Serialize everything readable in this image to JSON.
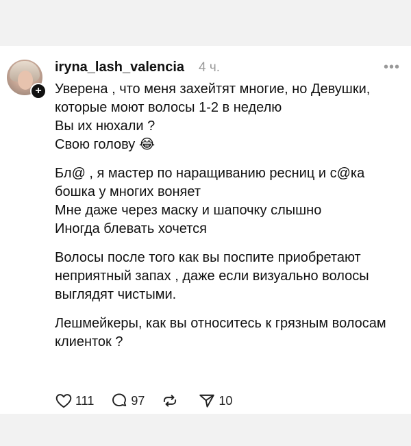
{
  "post": {
    "username": "iryna_lash_valencia",
    "time": "4 ч.",
    "more_label": "•••",
    "paragraphs": [
      "Уверена , что меня захейтят многие, но Девушки, которые моют волосы 1-2 в неделю\nВы их нюхали ?\nСвою голову 😂",
      "Бл@ , я мастер по наращиванию ресниц и с@ка бошка у многих воняет\nМне даже через маску и шапочку слышно\nИногда блевать хочется",
      "Волосы после того как вы поспите приобретают неприятный запах , даже если визуально волосы выглядят чистыми.",
      "Лешмейкеры, как вы относитесь к грязным волосам клиенток ?"
    ],
    "actions": {
      "likes": "111",
      "comments": "97",
      "reposts": "",
      "shares": "10"
    },
    "icons": {
      "like": "heart-icon",
      "comment": "comment-bubble-icon",
      "repost": "repost-icon",
      "share": "send-icon",
      "follow": "plus-badge-icon"
    }
  }
}
